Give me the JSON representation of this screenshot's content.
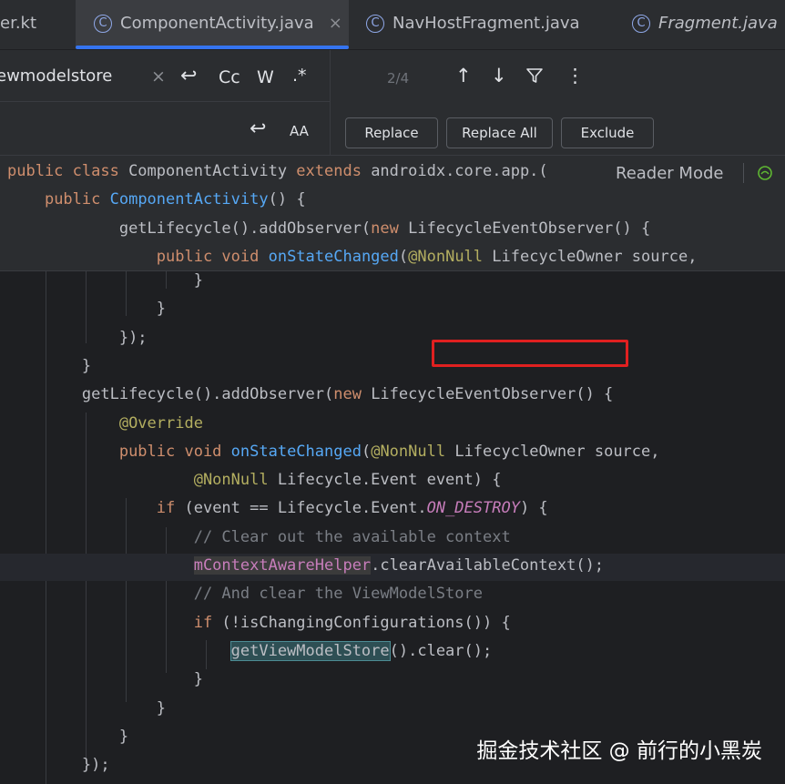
{
  "tabs": [
    {
      "label": "er.kt",
      "italic": false
    },
    {
      "label": "ComponentActivity.java",
      "italic": false,
      "active": true
    },
    {
      "label": "NavHostFragment.java",
      "italic": false
    },
    {
      "label": "Fragment.java",
      "italic": true
    }
  ],
  "tab_icon_letter": "C",
  "tab_close_glyph": "×",
  "search": {
    "query": "ewmodelstore",
    "clear_glyph": "×",
    "newline_glyph": "↩",
    "match_case": "Cc",
    "words": "W",
    "regex": ".*",
    "result_count": "2/4",
    "prev_glyph": "↑",
    "next_glyph": "↓",
    "filter_glyph": "⚲",
    "more_glyph": "⋮",
    "replace_newline_glyph": "↩",
    "preserve_case": "AA",
    "replace_label": "Replace",
    "replace_all_label": "Replace All",
    "exclude_label": "Exclude"
  },
  "reader_mode": "Reader Mode",
  "code": {
    "sticky": [
      {
        "indent": "",
        "parts": [
          [
            "kw",
            "public class "
          ],
          [
            "t",
            "ComponentActivity "
          ],
          [
            "kw",
            "extends "
          ],
          [
            "t",
            "androidx.core.app.("
          ]
        ]
      },
      {
        "indent": "    ",
        "parts": [
          [
            "kw",
            "public "
          ],
          [
            "fn",
            "ComponentActivity"
          ],
          [
            "t",
            "() {"
          ]
        ]
      },
      {
        "indent": "            ",
        "parts": [
          [
            "t",
            "getLifecycle().addObserver("
          ],
          [
            "kw",
            "new "
          ],
          [
            "t",
            "LifecycleEventObserver() {"
          ]
        ]
      },
      {
        "indent": "                ",
        "parts": [
          [
            "kw",
            "public void "
          ],
          [
            "fn",
            "onStateChanged"
          ],
          [
            "t",
            "("
          ],
          [
            "ann",
            "@NonNull "
          ],
          [
            "t",
            "LifecycleOwner source,"
          ]
        ]
      }
    ],
    "lines": [
      {
        "indent": "                    ",
        "parts": [
          [
            "t",
            "}"
          ]
        ]
      },
      {
        "indent": "                ",
        "parts": [
          [
            "t",
            "}"
          ]
        ]
      },
      {
        "indent": "            ",
        "parts": [
          [
            "t",
            "});"
          ]
        ]
      },
      {
        "indent": "        ",
        "parts": [
          [
            "t",
            "}"
          ]
        ]
      },
      {
        "indent": "        ",
        "parts": [
          [
            "t",
            "getLifecycle().addObserver("
          ],
          [
            "kw",
            "new "
          ],
          [
            "t",
            "LifecycleEventObserver() {"
          ]
        ]
      },
      {
        "indent": "            ",
        "parts": [
          [
            "ann",
            "@Override"
          ]
        ]
      },
      {
        "indent": "            ",
        "parts": [
          [
            "kw",
            "public void "
          ],
          [
            "fn",
            "onStateChanged"
          ],
          [
            "t",
            "("
          ],
          [
            "ann",
            "@NonNull "
          ],
          [
            "t",
            "LifecycleOwner source,"
          ]
        ]
      },
      {
        "indent": "                    ",
        "parts": [
          [
            "ann",
            "@NonNull "
          ],
          [
            "t",
            "Lifecycle.Event event) {"
          ]
        ]
      },
      {
        "indent": "                ",
        "parts": [
          [
            "kw",
            "if "
          ],
          [
            "t",
            "(event == Lifecycle.Event."
          ],
          [
            "const",
            "ON_DESTROY"
          ],
          [
            "t",
            ") {"
          ]
        ]
      },
      {
        "indent": "                    ",
        "parts": [
          [
            "cm",
            "// Clear out the available context"
          ]
        ]
      },
      {
        "indent": "                    ",
        "parts": [
          [
            "fldhl",
            "mContextAwareHelper"
          ],
          [
            "t",
            ".clearAvailableContext();"
          ]
        ]
      },
      {
        "indent": "                    ",
        "parts": [
          [
            "cm",
            "// And clear the ViewModelStore"
          ]
        ]
      },
      {
        "indent": "                    ",
        "parts": [
          [
            "kw",
            "if "
          ],
          [
            "t",
            "(!isChangingConfigurations()) {"
          ]
        ]
      },
      {
        "indent": "                        ",
        "parts": [
          [
            "hl",
            "getViewModelStore"
          ],
          [
            "t",
            "().clear();"
          ]
        ]
      },
      {
        "indent": "                    ",
        "parts": [
          [
            "t",
            "}"
          ]
        ]
      },
      {
        "indent": "                ",
        "parts": [
          [
            "t",
            "}"
          ]
        ]
      },
      {
        "indent": "            ",
        "parts": [
          [
            "t",
            "}"
          ]
        ]
      },
      {
        "indent": "        ",
        "parts": [
          [
            "t",
            "});"
          ]
        ]
      }
    ]
  },
  "watermark": "掘金技术社区 @ 前行的小黑炭",
  "colors": {
    "accent": "#3574f0",
    "highlight_box": "#e02020"
  }
}
